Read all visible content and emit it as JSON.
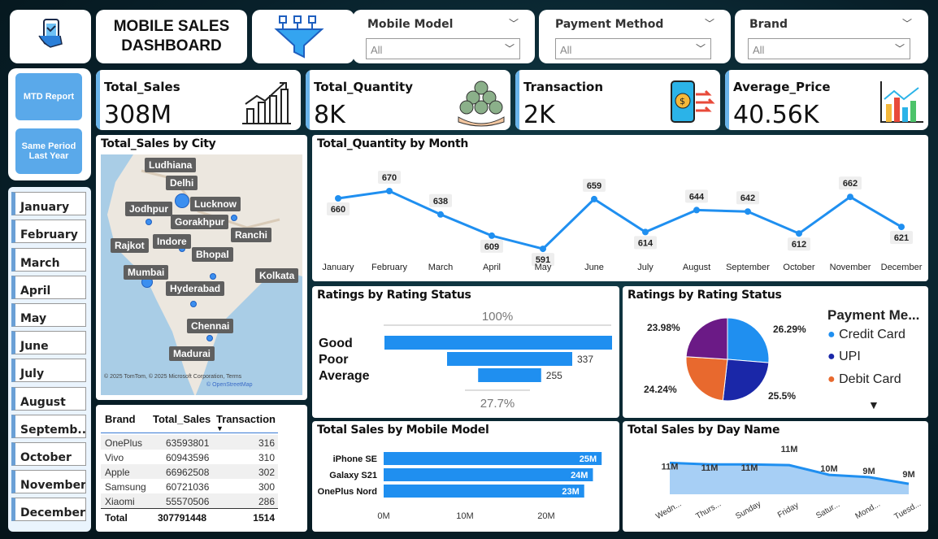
{
  "header": {
    "title_line1": "MOBILE SALES",
    "title_line2": "DASHBOARD"
  },
  "slicers": [
    {
      "label": "Mobile Model",
      "value": "All"
    },
    {
      "label": "Payment Method",
      "value": "All"
    },
    {
      "label": "Brand",
      "value": "All"
    }
  ],
  "nav": {
    "mtd": "MTD Report",
    "sply": "Same Period Last Year"
  },
  "kpis": [
    {
      "label": "Total_Sales",
      "value": "308M"
    },
    {
      "label": "Total_Quantity",
      "value": "8K"
    },
    {
      "label": "Transaction",
      "value": "2K"
    },
    {
      "label": "Average_Price",
      "value": "40.56K"
    }
  ],
  "months": [
    "January",
    "February",
    "March",
    "April",
    "May",
    "June",
    "July",
    "August",
    "Septemb...",
    "October",
    "November",
    "December"
  ],
  "map": {
    "title": "Total_Sales by City",
    "cities": [
      "Ludhiana",
      "Delhi",
      "Jodhpur",
      "Lucknow",
      "Gorakhpur",
      "Ranchi",
      "Rajkot",
      "Indore",
      "Bhopal",
      "Mumbai",
      "Kolkata",
      "Hyderabad",
      "Chennai",
      "Madurai"
    ],
    "attribution": "© 2025 TomTom, © 2025 Microsoft Corporation, Terms",
    "attribution2": "© OpenStreetMap"
  },
  "table": {
    "headers": [
      "Brand",
      "Total_Sales",
      "Transaction"
    ],
    "rows": [
      [
        "OnePlus",
        "63593801",
        "316"
      ],
      [
        "Vivo",
        "60943596",
        "310"
      ],
      [
        "Apple",
        "66962508",
        "302"
      ],
      [
        "Samsung",
        "60721036",
        "300"
      ],
      [
        "Xiaomi",
        "55570506",
        "286"
      ]
    ],
    "total": [
      "Total",
      "307791448",
      "1514"
    ]
  },
  "chart_data": [
    {
      "type": "line",
      "title": "Total_Quantity by Month",
      "categories": [
        "January",
        "February",
        "March",
        "April",
        "May",
        "June",
        "July",
        "August",
        "September",
        "October",
        "November",
        "December"
      ],
      "values": [
        660,
        670,
        638,
        609,
        591,
        659,
        614,
        644,
        642,
        612,
        662,
        621
      ],
      "color": "#1f8ff0"
    },
    {
      "type": "bar",
      "title": "Ratings by Rating Status",
      "categories": [
        "Good",
        "Poor",
        "Average"
      ],
      "values": [
        100,
        55,
        27.7
      ],
      "labels": [
        "",
        "337",
        "255"
      ],
      "top_label": "100%",
      "bottom_label": "27.7%",
      "color": "#1f8ff0"
    },
    {
      "type": "pie",
      "title": "Ratings by Rating Status",
      "legend_title": "Payment Me...",
      "series": [
        {
          "name": "Credit Card",
          "value": 26.29,
          "color": "#1f8ff0",
          "label": "26.29%"
        },
        {
          "name": "Debit Card",
          "value": 24.24,
          "color": "#e8692e",
          "label": "24.24%"
        },
        {
          "name": "UPI",
          "value": 25.5,
          "color": "#1a27a8",
          "label": "25.5%"
        },
        {
          "name": "",
          "value": 23.98,
          "color": "#6b1a86",
          "label": "23.98%"
        }
      ]
    },
    {
      "type": "bar",
      "title": "Total Sales by Mobile Model",
      "categories": [
        "iPhone SE",
        "Galaxy S21",
        "OnePlus Nord"
      ],
      "values": [
        25,
        24,
        23
      ],
      "labels": [
        "25M",
        "24M",
        "23M"
      ],
      "xticks": [
        "0M",
        "10M",
        "20M"
      ],
      "xlim": [
        0,
        28
      ],
      "color": "#1f8ff0"
    },
    {
      "type": "area",
      "title": "Total Sales by Day Name",
      "categories": [
        "Wedn...",
        "Thurs...",
        "Sunday",
        "Friday",
        "Satur...",
        "Mond...",
        "Tuesd..."
      ],
      "values": [
        11.2,
        11.0,
        11.0,
        10.9,
        9.6,
        9.3,
        8.4
      ],
      "labels": [
        "11M",
        "11M",
        "11M",
        "11M",
        "10M",
        "9M",
        "9M"
      ],
      "color": "#1f8ff0"
    }
  ]
}
